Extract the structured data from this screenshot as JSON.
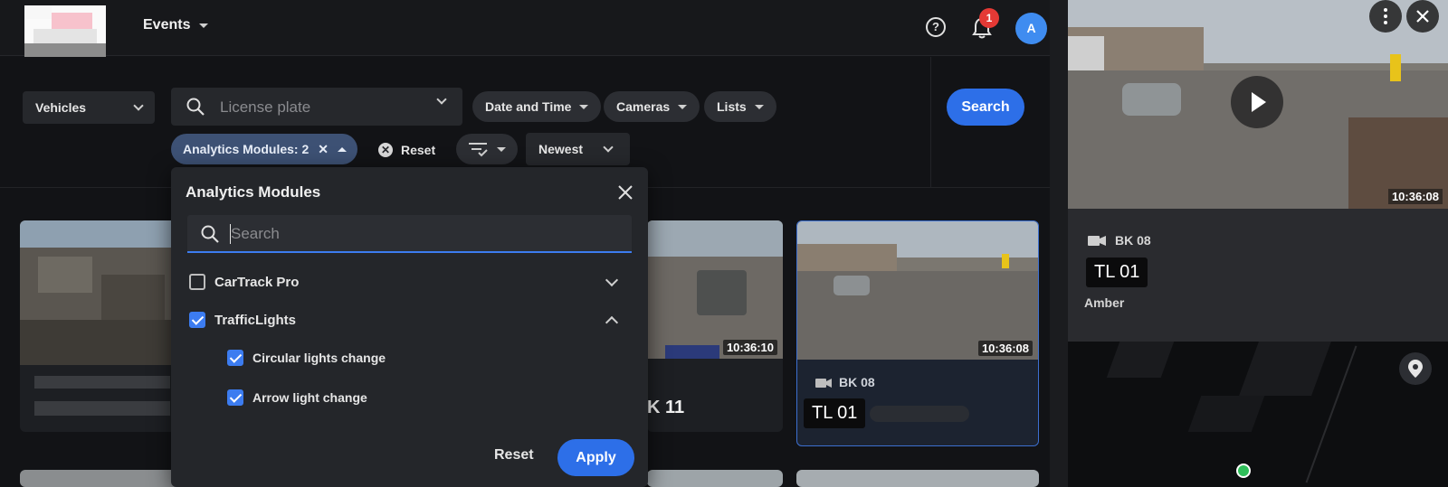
{
  "header": {
    "title": "Events",
    "notification_count": "1",
    "avatar_initial": "A"
  },
  "filters": {
    "object_type": "Vehicles",
    "plate_placeholder": "License plate",
    "date_time": "Date and Time",
    "cameras": "Cameras",
    "lists": "Lists",
    "search": "Search",
    "analytics_chip": "Analytics Modules: 2",
    "reset": "Reset",
    "sort": "Newest"
  },
  "dropdown": {
    "title": "Analytics Modules",
    "search_placeholder": "Search",
    "modules": [
      {
        "label": "CarTrack Pro",
        "checked": false,
        "expanded": false
      },
      {
        "label": "TrafficLights",
        "checked": true,
        "expanded": true,
        "children": [
          {
            "label": "Circular lights change",
            "checked": true
          },
          {
            "label": "Arrow light change",
            "checked": true
          }
        ]
      }
    ],
    "reset": "Reset",
    "apply": "Apply"
  },
  "results": [
    {
      "time": "10:36:10",
      "camera_suffix": "K 11"
    },
    {
      "time": "10:36:08",
      "camera": "BK 08",
      "plate": "TL 01"
    }
  ],
  "detail": {
    "time": "10:36:08",
    "camera": "BK 08",
    "plate": "TL 01",
    "light_state": "Amber"
  },
  "colors": {
    "accent": "#2d6fe8",
    "chip": "#3d5174",
    "badge": "#e53935"
  }
}
